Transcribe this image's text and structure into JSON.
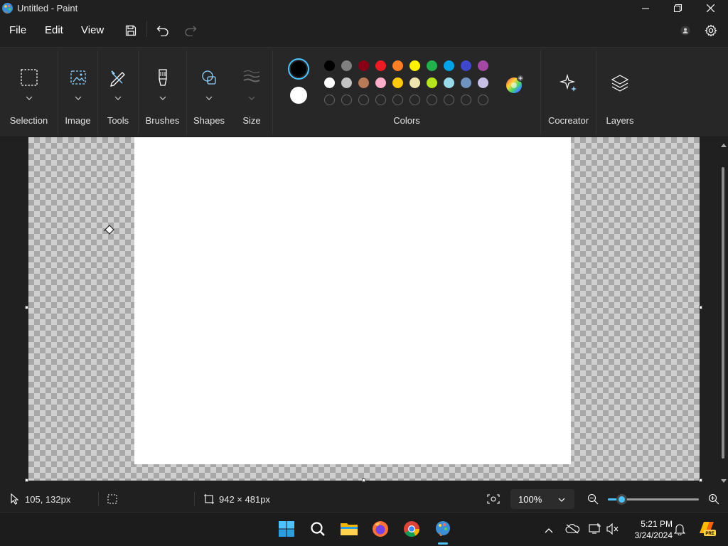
{
  "window": {
    "title": "Untitled - Paint",
    "app_icon": "paint-palette-icon"
  },
  "menu": {
    "file": "File",
    "edit": "Edit",
    "view": "View",
    "save_icon": "save-icon",
    "undo_icon": "undo-icon",
    "redo_icon": "redo-icon"
  },
  "ribbon": {
    "selection": "Selection",
    "image": "Image",
    "tools": "Tools",
    "brushes": "Brushes",
    "shapes": "Shapes",
    "size": "Size",
    "colors": "Colors",
    "cocreator": "Cocreator",
    "layers": "Layers",
    "primary_color": "#000000",
    "secondary_color": "#ffffff",
    "palette_row1": [
      "#000000",
      "#7f7f7f",
      "#880015",
      "#ed1c24",
      "#ff7f27",
      "#fff200",
      "#22b14c",
      "#00a2e8",
      "#3f48cc",
      "#a349a4"
    ],
    "palette_row2": [
      "#ffffff",
      "#c3c3c3",
      "#b97a57",
      "#ffaec9",
      "#ffc90e",
      "#efe4b0",
      "#b5e61d",
      "#99d9ea",
      "#7092be",
      "#c8bfe7"
    ]
  },
  "status": {
    "cursor_pos": "105, 132px",
    "canvas_size": "942 × 481px",
    "zoom": "100%",
    "zoom_level": 0.15
  },
  "taskbar": {
    "time": "5:21 PM",
    "date": "3/24/2024"
  },
  "colors": {
    "accent": "#4cc2ff"
  }
}
